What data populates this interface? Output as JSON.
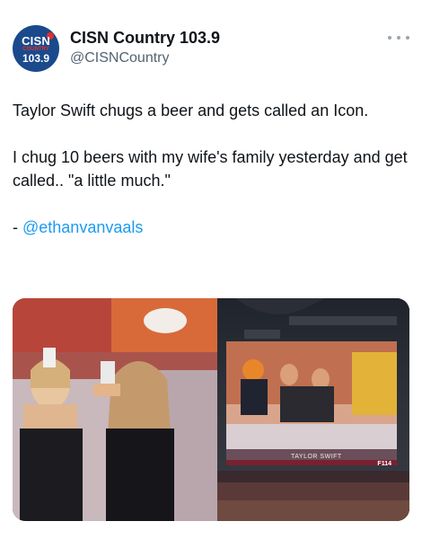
{
  "account": {
    "display_name": "CISN Country 103.9",
    "handle": "@CISNCountry",
    "avatar": {
      "logo_top": "CISN",
      "logo_mid": "COUNTRY",
      "logo_bottom": "103.9"
    }
  },
  "tweet": {
    "line1": "Taylor Swift chugs a beer and gets called an Icon.",
    "line2": "I chug 10 beers with my wife's family yesterday and get called.. \"a little much.\"",
    "attribution_prefix": "- ",
    "attribution_mention": "@ethanvanvaals"
  },
  "media": {
    "screen_label": "TAYLOR SWIFT",
    "screen_code": "F114"
  },
  "icons": {
    "more": "more-horizontal-icon"
  },
  "colors": {
    "mention": "#1d9bf0",
    "handle": "#536471",
    "avatar_bg": "#1a4a8c",
    "avatar_accent": "#e0312b"
  }
}
